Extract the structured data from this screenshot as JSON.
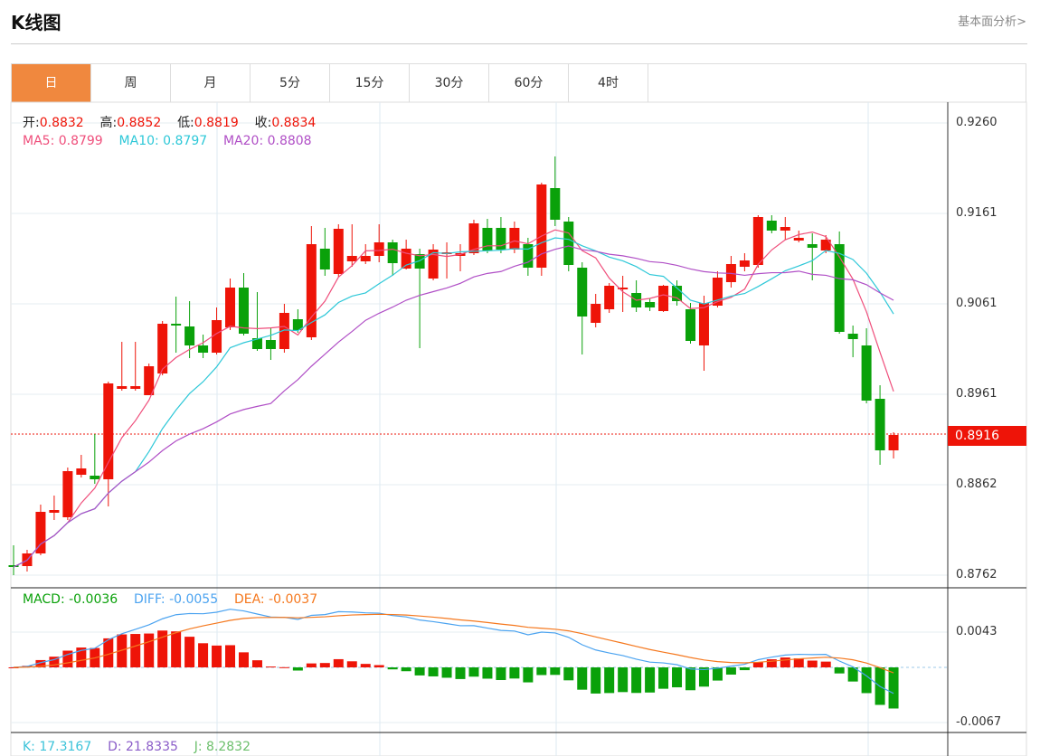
{
  "header": {
    "title": "K线图",
    "link": "基本面分析>"
  },
  "tabs": [
    "日",
    "周",
    "月",
    "5分",
    "15分",
    "30分",
    "60分",
    "4时"
  ],
  "active_tab": 0,
  "info": {
    "open_label": "开:",
    "open": "0.8832",
    "high_label": "高:",
    "high": "0.8852",
    "low_label": "低:",
    "low": "0.8819",
    "close_label": "收:",
    "close": "0.8834",
    "ma5": "MA5: 0.8799",
    "ma10": "MA10: 0.8797",
    "ma20": "MA20: 0.8808"
  },
  "macd_info": {
    "macd": "MACD: -0.0036",
    "diff": "DIFF: -0.0055",
    "dea": "DEA: -0.0037"
  },
  "kdj_info": {
    "k": "K: 17.3167",
    "d": "D: 21.8335",
    "j": "J: 8.2832"
  },
  "colors": {
    "up": "#ee1408",
    "down": "#0aa10a",
    "ma5": "#ef4e7b",
    "ma10": "#2ec8d8",
    "ma20": "#b04fc6",
    "diff": "#4ba3f0",
    "dea": "#f5781e",
    "accent": "#f0883e"
  },
  "chart_data": {
    "type": "candlestick",
    "price_axis": {
      "ticks": [
        "0.9260",
        "0.9161",
        "0.9061",
        "0.8961",
        "0.8862",
        "0.8762"
      ],
      "range": [
        0.8755,
        0.9284
      ]
    },
    "macd_axis": {
      "ticks": [
        "0.0043",
        "-0.0067"
      ]
    },
    "current_price": "0.8916",
    "ohlc": [
      [
        0.8771,
        0.8769,
        0.8793,
        0.876
      ],
      [
        0.877,
        0.8784,
        0.8788,
        0.8764
      ],
      [
        0.8784,
        0.883,
        0.8838,
        0.8782
      ],
      [
        0.8829,
        0.8832,
        0.8848,
        0.8821
      ],
      [
        0.8824,
        0.8875,
        0.8879,
        0.8821
      ],
      [
        0.8871,
        0.8878,
        0.8893,
        0.8868
      ],
      [
        0.887,
        0.8866,
        0.8916,
        0.8861
      ],
      [
        0.8866,
        0.8972,
        0.8974,
        0.8836
      ],
      [
        0.8966,
        0.8969,
        0.9018,
        0.8964
      ],
      [
        0.8966,
        0.8969,
        0.9018,
        0.8964
      ],
      [
        0.8959,
        0.8991,
        0.8994,
        0.8959
      ],
      [
        0.8983,
        0.9038,
        0.9041,
        0.8981
      ],
      [
        0.9038,
        0.9036,
        0.9068,
        0.9006
      ],
      [
        0.9035,
        0.9014,
        0.9063,
        0.9
      ],
      [
        0.9014,
        0.9006,
        0.9026,
        0.9
      ],
      [
        0.9006,
        0.9042,
        0.9056,
        0.9004
      ],
      [
        0.9034,
        0.9078,
        0.9088,
        0.9031
      ],
      [
        0.9078,
        0.9027,
        0.9094,
        0.9025
      ],
      [
        0.9022,
        0.901,
        0.9073,
        0.9008
      ],
      [
        0.902,
        0.901,
        0.9034,
        0.8998
      ],
      [
        0.901,
        0.905,
        0.906,
        0.9006
      ],
      [
        0.9043,
        0.9031,
        0.9054,
        0.9028
      ],
      [
        0.9023,
        0.9126,
        0.9146,
        0.902
      ],
      [
        0.9121,
        0.9098,
        0.9144,
        0.9091
      ],
      [
        0.9093,
        0.9143,
        0.9148,
        0.909
      ],
      [
        0.9107,
        0.9113,
        0.9148,
        0.9101
      ],
      [
        0.9107,
        0.9113,
        0.9126,
        0.9104
      ],
      [
        0.9113,
        0.9128,
        0.9148,
        0.9106
      ],
      [
        0.9128,
        0.9105,
        0.9131,
        0.9091
      ],
      [
        0.9099,
        0.9121,
        0.9131,
        0.9098
      ],
      [
        0.9115,
        0.9099,
        0.9121,
        0.9011
      ],
      [
        0.9088,
        0.912,
        0.9126,
        0.9086
      ],
      [
        0.9115,
        0.9117,
        0.9128,
        0.9088
      ],
      [
        0.9113,
        0.9116,
        0.9126,
        0.9096
      ],
      [
        0.9116,
        0.9149,
        0.9153,
        0.9114
      ],
      [
        0.9144,
        0.9119,
        0.9154,
        0.9116
      ],
      [
        0.9144,
        0.912,
        0.9156,
        0.9116
      ],
      [
        0.912,
        0.9144,
        0.9151,
        0.9116
      ],
      [
        0.9126,
        0.91,
        0.9133,
        0.9091
      ],
      [
        0.91,
        0.9192,
        0.9194,
        0.9091
      ],
      [
        0.9188,
        0.9153,
        0.9223,
        0.9146
      ],
      [
        0.9151,
        0.9103,
        0.9156,
        0.9096
      ],
      [
        0.91,
        0.9046,
        0.9106,
        0.9004
      ],
      [
        0.9039,
        0.906,
        0.9071,
        0.9034
      ],
      [
        0.9054,
        0.908,
        0.9083,
        0.905
      ],
      [
        0.9076,
        0.9078,
        0.9091,
        0.9051
      ],
      [
        0.9072,
        0.9056,
        0.9086,
        0.9051
      ],
      [
        0.9062,
        0.9056,
        0.9066,
        0.9052
      ],
      [
        0.9052,
        0.908,
        0.9081,
        0.9051
      ],
      [
        0.908,
        0.9063,
        0.9086,
        0.9058
      ],
      [
        0.9054,
        0.9019,
        0.9061,
        0.9016
      ],
      [
        0.9014,
        0.9061,
        0.9069,
        0.8986
      ],
      [
        0.9058,
        0.9089,
        0.9096,
        0.9056
      ],
      [
        0.9084,
        0.9104,
        0.9113,
        0.9078
      ],
      [
        0.9101,
        0.9108,
        0.9116,
        0.9096
      ],
      [
        0.9103,
        0.9156,
        0.9158,
        0.91
      ],
      [
        0.9152,
        0.9141,
        0.9158,
        0.9138
      ],
      [
        0.9141,
        0.9145,
        0.9156,
        0.9131
      ],
      [
        0.913,
        0.9133,
        0.9141,
        0.9128
      ],
      [
        0.9126,
        0.9122,
        0.9138,
        0.9086
      ],
      [
        0.9119,
        0.9131,
        0.9136,
        0.9116
      ],
      [
        0.9126,
        0.9029,
        0.914,
        0.9027
      ],
      [
        0.9027,
        0.9021,
        0.9036,
        0.9001
      ],
      [
        0.9014,
        0.8953,
        0.9033,
        0.895
      ],
      [
        0.8955,
        0.8898,
        0.897,
        0.8882
      ],
      [
        0.8898,
        0.8915,
        0.8918,
        0.8889
      ]
    ]
  }
}
